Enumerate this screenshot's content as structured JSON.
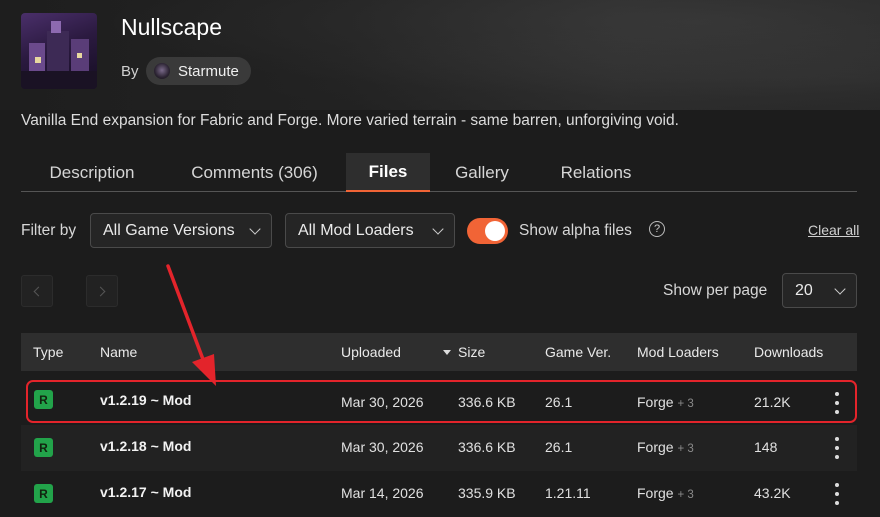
{
  "project": {
    "title": "Nullscape",
    "by_label": "By",
    "author": "Starmute",
    "summary": "Vanilla End expansion for Fabric and Forge. More varied terrain - same barren, unforgiving void."
  },
  "tabs": [
    {
      "label": "Description",
      "active": false
    },
    {
      "label": "Comments (306)",
      "active": false
    },
    {
      "label": "Files",
      "active": true
    },
    {
      "label": "Gallery",
      "active": false
    },
    {
      "label": "Relations",
      "active": false
    }
  ],
  "filters": {
    "label": "Filter by",
    "game_versions": "All Game Versions",
    "mod_loaders": "All Mod Loaders",
    "alpha_label": "Show alpha files",
    "alpha_enabled": true,
    "clear_all": "Clear all"
  },
  "pagination": {
    "per_page_label": "Show per page",
    "per_page_value": "20"
  },
  "table": {
    "headers": {
      "type": "Type",
      "name": "Name",
      "uploaded": "Uploaded",
      "size": "Size",
      "game_ver": "Game Ver.",
      "mod_loaders": "Mod Loaders",
      "downloads": "Downloads"
    },
    "rows": [
      {
        "type": "R",
        "name": "v1.2.19 ~ Mod",
        "uploaded": "Mar 30, 2026",
        "size": "336.6 KB",
        "game_ver": "26.1",
        "loader": "Forge",
        "loader_extra": "+ 3",
        "downloads": "21.2K"
      },
      {
        "type": "R",
        "name": "v1.2.18 ~ Mod",
        "uploaded": "Mar 30, 2026",
        "size": "336.6 KB",
        "game_ver": "26.1",
        "loader": "Forge",
        "loader_extra": "+ 3",
        "downloads": "148"
      },
      {
        "type": "R",
        "name": "v1.2.17 ~ Mod",
        "uploaded": "Mar 14, 2026",
        "size": "335.9 KB",
        "game_ver": "1.21.11",
        "loader": "Forge",
        "loader_extra": "+ 3",
        "downloads": "43.2K"
      }
    ]
  },
  "colors": {
    "accent": "#f16436",
    "release_badge": "#22a34a",
    "annotation": "#e3242b"
  }
}
